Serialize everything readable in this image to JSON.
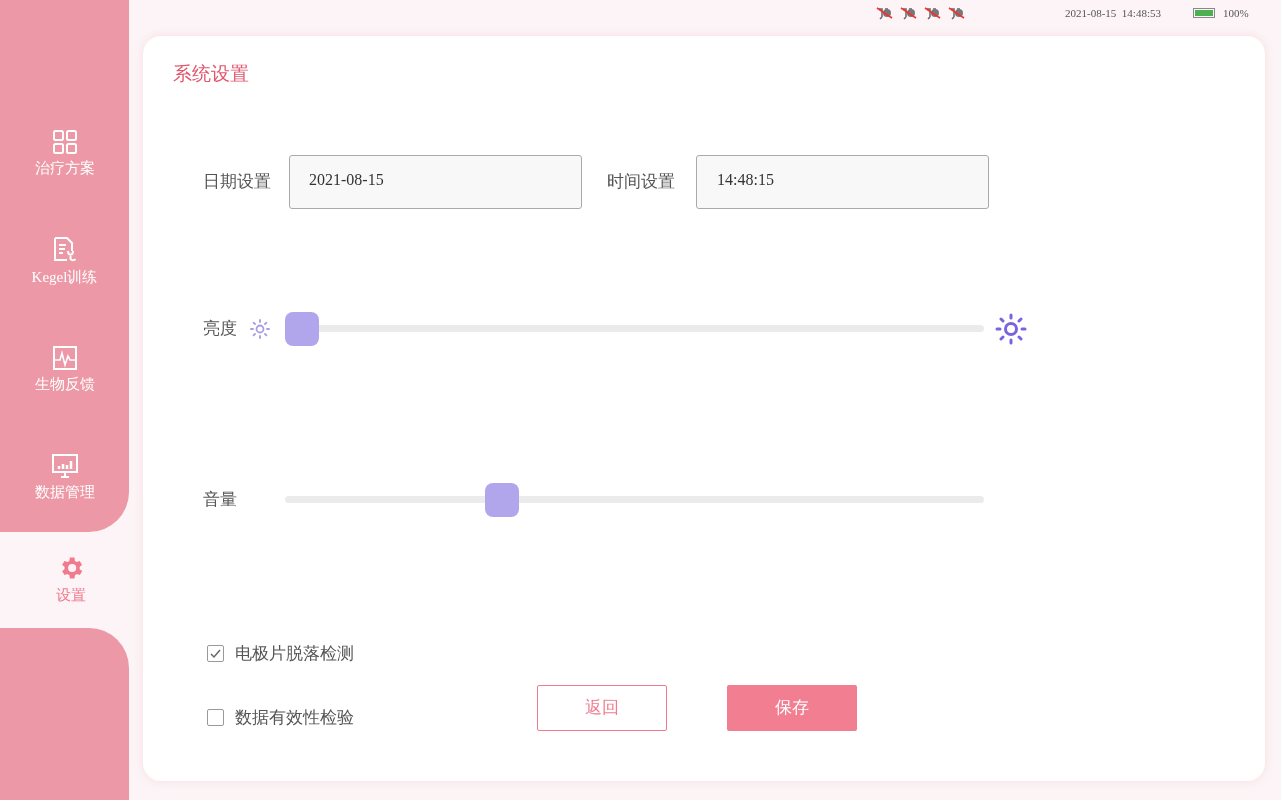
{
  "status_bar": {
    "plug_indicators": [
      {
        "connected": false
      },
      {
        "connected": false
      },
      {
        "connected": false
      },
      {
        "connected": false
      }
    ],
    "datetime": "2021-08-15  14:48:53",
    "battery": {
      "level": 1,
      "label": "100%"
    }
  },
  "sidebar": {
    "items": [
      {
        "label": "治疗方案",
        "kind": "grid",
        "selected": false
      },
      {
        "label": "Kegel训练",
        "kind": "report",
        "selected": false
      },
      {
        "label": "生物反馈",
        "kind": "pulse",
        "selected": false
      },
      {
        "label": "数据管理",
        "kind": "monitor",
        "selected": false
      },
      {
        "label": "设置",
        "kind": "gear",
        "selected": true
      }
    ]
  },
  "page": {
    "title": "系统设置",
    "date": {
      "label": "日期设置",
      "value": "2021-08-15"
    },
    "time": {
      "label": "时间设置",
      "value": "14:48:15"
    },
    "brightness": {
      "label": "亮度",
      "level": 0
    },
    "volume": {
      "label": "音量",
      "level": 0.3
    },
    "checks": [
      {
        "label": "电极片脱落检测",
        "checked": true
      },
      {
        "label": "数据有效性检验",
        "checked": false
      }
    ],
    "buttons": {
      "back": "返回",
      "save": "保存"
    }
  }
}
